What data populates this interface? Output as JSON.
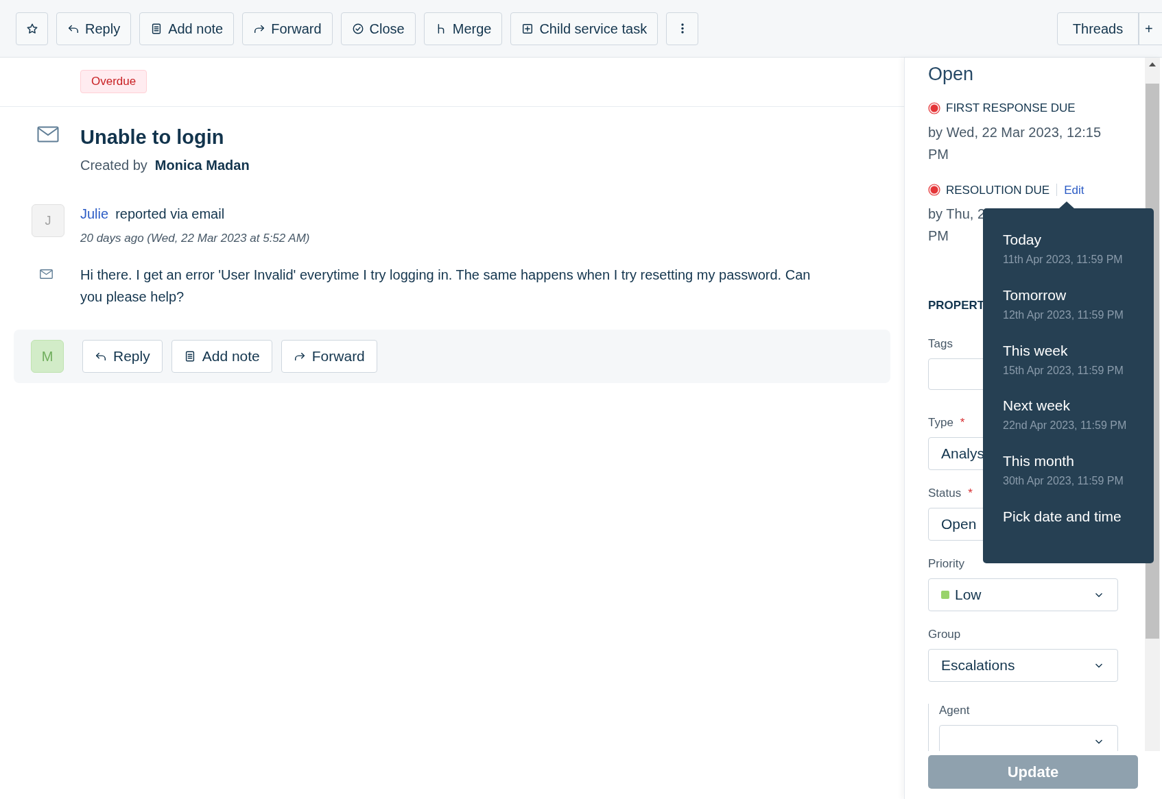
{
  "toolbar": {
    "buttons": [
      {
        "kind": "star"
      },
      {
        "kind": "reply",
        "label": "Reply"
      },
      {
        "kind": "note",
        "label": "Add note"
      },
      {
        "kind": "forward",
        "label": "Forward"
      },
      {
        "kind": "close",
        "label": "Close"
      },
      {
        "kind": "merge",
        "label": "Merge"
      },
      {
        "kind": "child",
        "label": "Child service task"
      },
      {
        "kind": "more"
      }
    ],
    "right_buttons": [
      {
        "label": "Threads"
      },
      {
        "label": "+"
      }
    ]
  },
  "ticket": {
    "badge": "Overdue",
    "title": "Unable to login",
    "created_by_label": "Created by",
    "created_by": "Monica Madan",
    "message": {
      "avatar": "J",
      "author": "Julie",
      "via": "reported via email",
      "time": "20 days ago (Wed, 22 Mar 2023 at 5:52 AM)",
      "body": "Hi there. I get an error 'User Invalid' everytime I try logging in. The same happens when I try resetting my password. Can you please help?"
    },
    "reply_bar": {
      "avatar": "M",
      "buttons": [
        {
          "kind": "reply",
          "label": "Reply"
        },
        {
          "kind": "note",
          "label": "Add note"
        },
        {
          "kind": "forward",
          "label": "Forward"
        }
      ]
    }
  },
  "sidebar": {
    "status": "Open",
    "sla": [
      {
        "label": "FIRST RESPONSE DUE",
        "value_lines": [
          "by Wed, 22 Mar 2023, 12:15",
          "PM"
        ]
      },
      {
        "label": "RESOLUTION DUE",
        "link": "Edit",
        "value_lines": [
          "by Thu, 2",
          "PM"
        ]
      }
    ],
    "properties_heading": "PROPERT",
    "fields": [
      {
        "label": "Tags",
        "kind": "tags"
      },
      {
        "label": "Type",
        "kind": "select",
        "required_mark": "*",
        "value": "Analys"
      },
      {
        "label": "Status",
        "kind": "select",
        "required_mark": "*",
        "value": "Open"
      },
      {
        "label": "Priority",
        "kind": "select",
        "value": "Low",
        "color": "#99d36b",
        "chevron": true
      },
      {
        "label": "Group",
        "kind": "select",
        "value": "Escalations",
        "chevron": true
      },
      {
        "label": "Agent",
        "kind": "nested",
        "chevron": true
      }
    ],
    "update_button": "Update",
    "due_menu": [
      {
        "label": "Today",
        "date": "11th Apr 2023, 11:59 PM"
      },
      {
        "label": "Tomorrow",
        "date": "12th Apr 2023, 11:59 PM"
      },
      {
        "label": "This week",
        "date": "15th Apr 2023, 11:59 PM"
      },
      {
        "label": "Next week",
        "date": "22nd Apr 2023, 11:59 PM"
      },
      {
        "label": "This month",
        "date": "30th Apr 2023, 11:59 PM"
      },
      {
        "label": "Pick date and time"
      }
    ]
  }
}
